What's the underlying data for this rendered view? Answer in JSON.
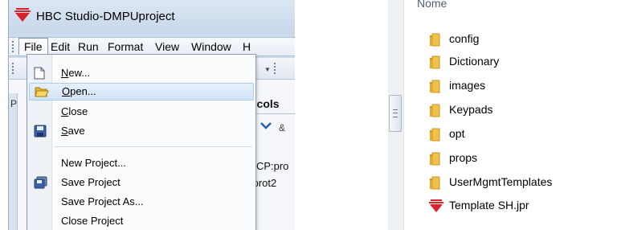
{
  "window": {
    "title": "HBC Studio-DMPUproject"
  },
  "menubar": {
    "items": [
      {
        "label": "File"
      },
      {
        "label": "Edit"
      },
      {
        "label": "Run"
      },
      {
        "label": "Format"
      },
      {
        "label": "View"
      },
      {
        "label": "Window"
      },
      {
        "label": "H"
      }
    ]
  },
  "file_menu": {
    "items": [
      {
        "label": "New...",
        "icon": "new-file-icon",
        "highlighted": false
      },
      {
        "label": "Open...",
        "icon": "open-folder-icon",
        "highlighted": true
      },
      {
        "label": "Close",
        "icon": "",
        "highlighted": false
      },
      {
        "label": "Save",
        "icon": "save-disk-icon",
        "highlighted": false
      },
      {
        "label": "New Project...",
        "icon": "",
        "highlighted": false
      },
      {
        "label": "Save Project",
        "icon": "save-project-icon",
        "highlighted": false
      },
      {
        "label": "Save Project As...",
        "icon": "",
        "highlighted": false
      },
      {
        "label": "Close Project",
        "icon": "",
        "highlighted": false
      }
    ]
  },
  "background": {
    "tab_label": "ocols",
    "row1": "TCP:pro",
    "row2": ":prot2",
    "left_letter": "P"
  },
  "explorer": {
    "column_header": "Nome",
    "items": [
      {
        "name": "config",
        "type": "folder"
      },
      {
        "name": "Dictionary",
        "type": "folder"
      },
      {
        "name": "images",
        "type": "folder"
      },
      {
        "name": "Keypads",
        "type": "folder"
      },
      {
        "name": "opt",
        "type": "folder"
      },
      {
        "name": "props",
        "type": "folder"
      },
      {
        "name": "UserMgmtTemplates",
        "type": "folder"
      },
      {
        "name": "Template SH.jpr",
        "type": "project-file"
      }
    ]
  },
  "colors": {
    "brand_red": "#d9232d",
    "folder_yellow": "#e8b531",
    "highlight": "#d3e3f6"
  }
}
